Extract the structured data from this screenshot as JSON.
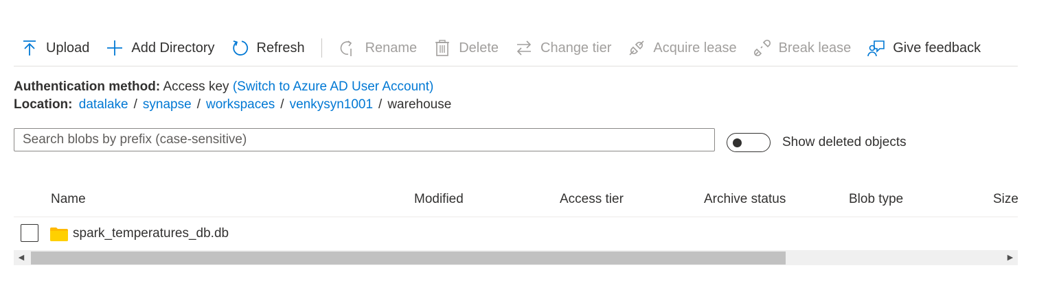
{
  "toolbar": {
    "upload": "Upload",
    "add_directory": "Add Directory",
    "refresh": "Refresh",
    "rename": "Rename",
    "delete": "Delete",
    "change_tier": "Change tier",
    "acquire_lease": "Acquire lease",
    "break_lease": "Break lease",
    "give_feedback": "Give feedback"
  },
  "auth": {
    "label": "Authentication method:",
    "value": "Access key",
    "switch_link": "(Switch to Azure AD User Account)"
  },
  "location": {
    "label": "Location:",
    "crumbs": [
      "datalake",
      "synapse",
      "workspaces",
      "venkysyn1001"
    ],
    "current": "warehouse",
    "separator": "/"
  },
  "search": {
    "placeholder": "Search blobs by prefix (case-sensitive)",
    "value": ""
  },
  "toggle": {
    "label": "Show deleted objects",
    "on": false
  },
  "table": {
    "columns": [
      "Name",
      "Modified",
      "Access tier",
      "Archive status",
      "Blob type",
      "Size"
    ],
    "rows": [
      {
        "name": "spark_temperatures_db.db",
        "type": "folder",
        "selected": false
      }
    ]
  },
  "colors": {
    "accent": "#0078d4",
    "folder": "#ffb900",
    "disabled": "#a19f9d",
    "text": "#323130"
  }
}
